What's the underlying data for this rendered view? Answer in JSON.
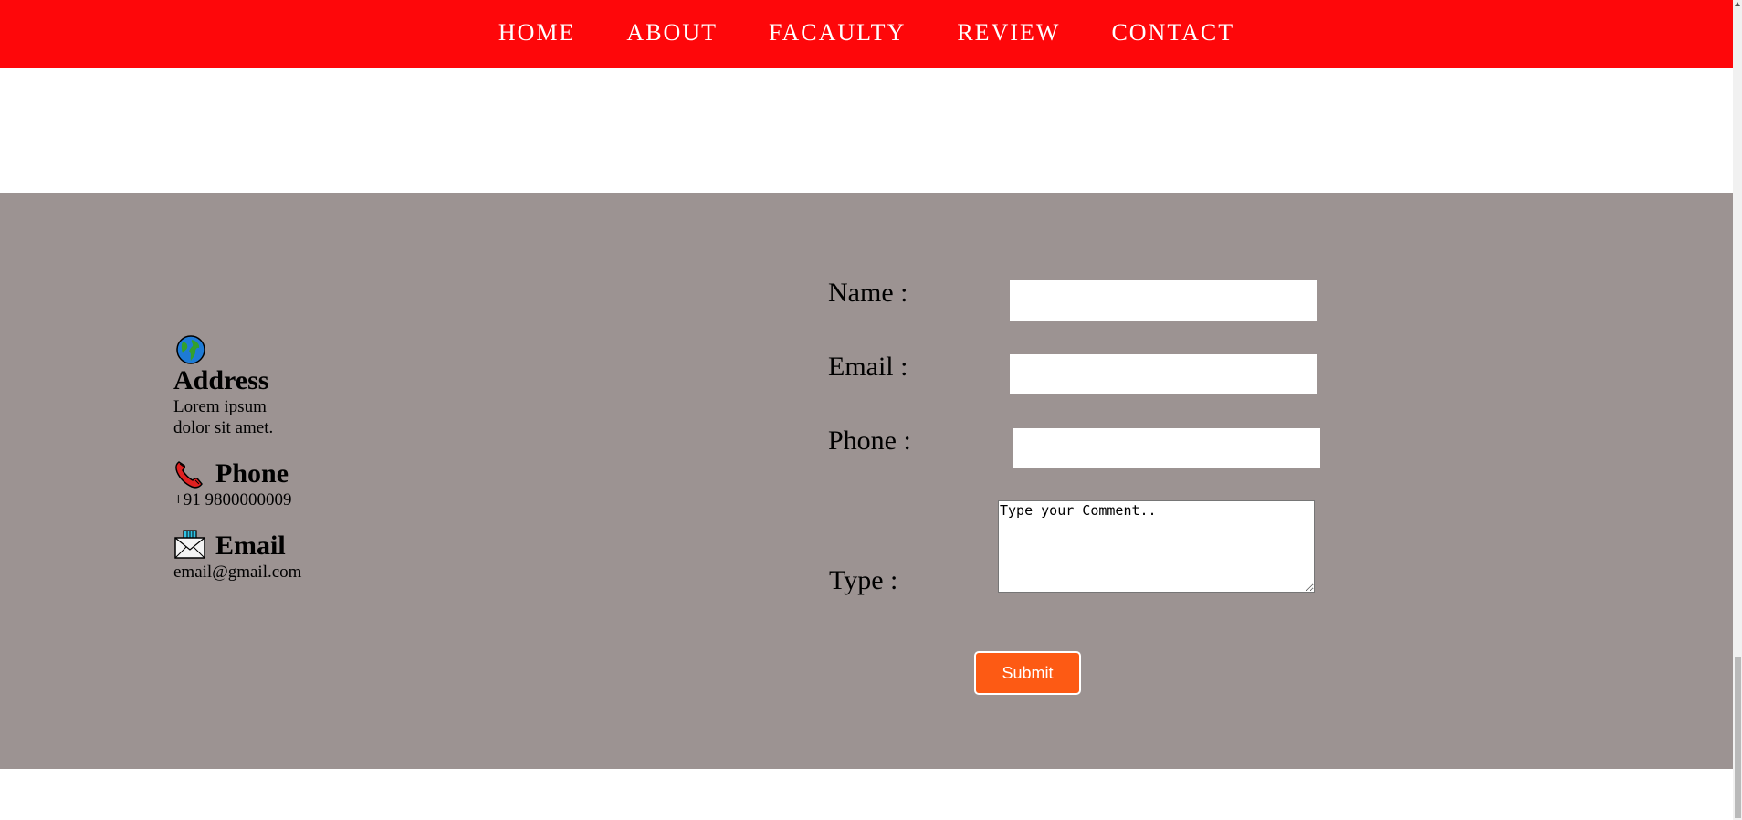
{
  "nav": {
    "items": [
      {
        "label": "HOME"
      },
      {
        "label": "ABOUT"
      },
      {
        "label": "FACAULTY"
      },
      {
        "label": "REVIEW"
      },
      {
        "label": "CONTACT"
      }
    ],
    "background": "#fe070a"
  },
  "contact": {
    "background": "#9c9392",
    "address": {
      "icon": "globe-icon",
      "title": "Address",
      "text": "Lorem ipsum dolor sit amet."
    },
    "phone": {
      "icon": "telephone-icon",
      "title": "Phone",
      "text": "+91 9800000009"
    },
    "email": {
      "icon": "mailbox-icon",
      "title": "Email",
      "text": "email@gmail.com"
    }
  },
  "form": {
    "name_label": "Name :",
    "email_label": "Email :",
    "phone_label": "Phone :",
    "type_label": "Type :",
    "comment_placeholder": "Type your Comment..",
    "submit_label": "Submit",
    "submit_color": "#fd5a14"
  }
}
